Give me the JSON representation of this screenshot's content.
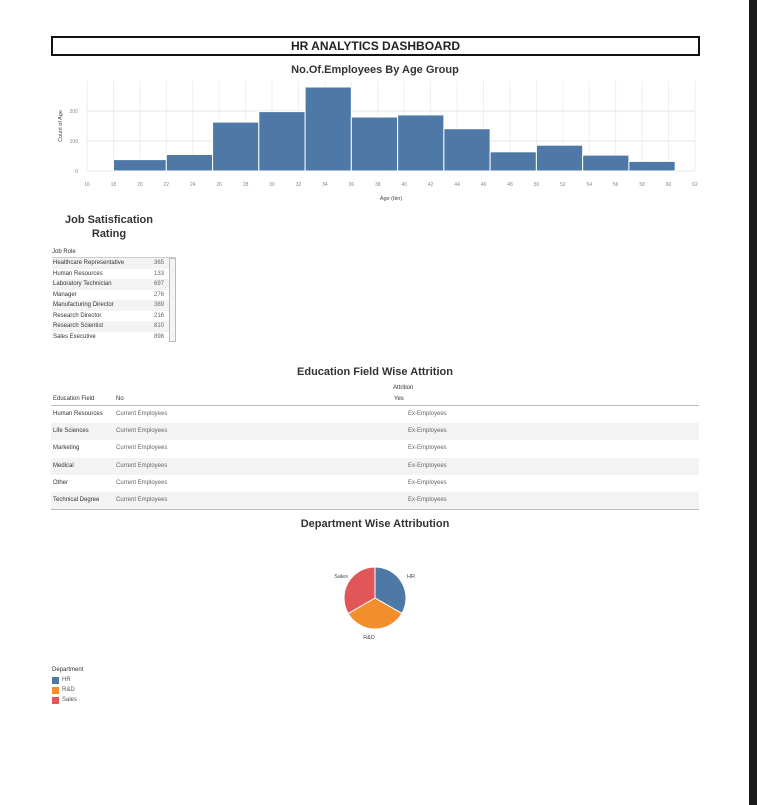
{
  "dashboard_title": "HR ANALYTICS DASHBOARD",
  "sections": {
    "age": "No.Of.Employees By Age Group",
    "job_sat_line1": "Job Satisfication",
    "job_sat_line2": "Rating",
    "education": "Education Field Wise Attrition",
    "department": "Department Wise Attribution"
  },
  "colors": {
    "blue": "#4e79a7",
    "orange": "#f28e2b",
    "red": "#e15759"
  },
  "chart_data": [
    {
      "type": "bar",
      "title": "No.Of.Employees By Age Group",
      "xlabel": "Age (bin)",
      "ylabel": "Count of Age",
      "bins": [
        18,
        20,
        24,
        28,
        32,
        36,
        40,
        44,
        48,
        52,
        56
      ],
      "bin_edges": [
        18,
        22,
        25.5,
        29,
        32.5,
        36,
        39.5,
        43,
        46.5,
        50,
        53.5,
        57,
        60.5
      ],
      "values": [
        38,
        55,
        163,
        198,
        280,
        180,
        187,
        141,
        64,
        86,
        53,
        32
      ],
      "xticks": [
        16,
        18,
        20,
        22,
        24,
        26,
        28,
        30,
        32,
        34,
        36,
        38,
        40,
        42,
        44,
        46,
        48,
        50,
        52,
        54,
        56,
        58,
        60,
        62
      ],
      "yticks": [
        0,
        100,
        200
      ],
      "xlim": [
        16,
        62
      ],
      "ylim": [
        0,
        300
      ],
      "grid": true
    },
    {
      "type": "table",
      "title": "Job Satisfication Rating",
      "column": "Job Role",
      "rows": [
        {
          "role": "Healthcare Representative",
          "value": "365"
        },
        {
          "role": "Human Resources",
          "value": "133"
        },
        {
          "role": "Laboratory Technician",
          "value": "697"
        },
        {
          "role": "Manager",
          "value": "276"
        },
        {
          "role": "Manufacturing Director",
          "value": "389"
        },
        {
          "role": "Research Director",
          "value": "216"
        },
        {
          "role": "Research Scientist",
          "value": "810"
        },
        {
          "role": "Sales Executive",
          "value": "898"
        }
      ]
    },
    {
      "type": "table",
      "title": "Education Field Wise Attrition",
      "group_header": "Attrition",
      "columns": [
        "Education Field",
        "No",
        "Yes"
      ],
      "rows": [
        [
          "Human Resources",
          "Current Employees",
          "Ex-Employees"
        ],
        [
          "Life Sciences",
          "Current Employees",
          "Ex-Employees"
        ],
        [
          "Marketing",
          "Current Employees",
          "Ex-Employees"
        ],
        [
          "Medical",
          "Current Employees",
          "Ex-Employees"
        ],
        [
          "Other",
          "Current Employees",
          "Ex-Employees"
        ],
        [
          "Technical Degree",
          "Current Employees",
          "Ex-Employees"
        ]
      ]
    },
    {
      "type": "pie",
      "title": "Department Wise Attribution",
      "legend_title": "Department",
      "legend_position": "bottom-left",
      "slices": [
        {
          "label": "HR",
          "value": 33.3,
          "color": "#4e79a7"
        },
        {
          "label": "R&D",
          "value": 33.3,
          "color": "#f28e2b"
        },
        {
          "label": "Sales",
          "value": 33.4,
          "color": "#e15759"
        }
      ]
    }
  ]
}
